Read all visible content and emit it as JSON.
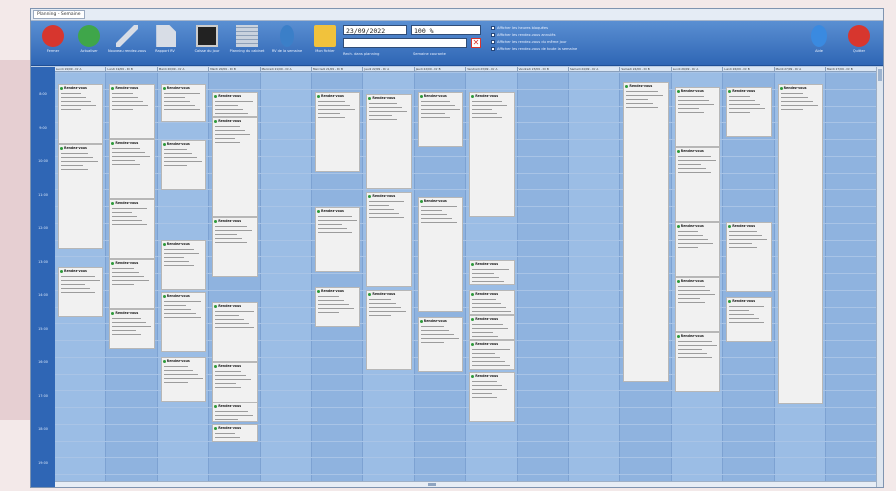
{
  "window": {
    "title": "Planning - Semaine"
  },
  "toolbar": {
    "buttons": [
      {
        "label": "Fermer",
        "icon": "close-red-icon",
        "color": "#d7362e"
      },
      {
        "label": "Actualiser",
        "icon": "refresh-icon",
        "color": "#3fa64a"
      },
      {
        "label": "Nouveau rendez-vous",
        "icon": "pen-icon",
        "color": "#d8dde6"
      },
      {
        "label": "Rapport RV",
        "icon": "document-arrow-icon",
        "color": "#d8dde6"
      },
      {
        "label": "Caisse du jour",
        "icon": "cash-register-icon",
        "color": "#222"
      },
      {
        "label": "Planning du cabinet",
        "icon": "calendar-grid-icon",
        "color": "#c9d2de"
      },
      {
        "label": "RV de la semaine",
        "icon": "person-icon",
        "color": "#3b7fc8"
      },
      {
        "label": "Mon fichier",
        "icon": "folder-icon",
        "color": "#f1c23c"
      }
    ],
    "date_value": "23/09/2022",
    "zoom_value": "100 %",
    "search_placeholder": "",
    "search_label": "Rech. dans planning",
    "current_week_label": "Semaine courante",
    "options": [
      "Afficher les heures bloquées",
      "Afficher les rendez-vous annulés",
      "Afficher les rendez-vous du même jour",
      "Afficher les rendez-vous de toute la semaine"
    ],
    "help_label": "Aide",
    "quit_label": "Quitter",
    "help_color": "#3a8ae0",
    "quit_color": "#d7362e"
  },
  "grid": {
    "times": [
      "8:00",
      "9:00",
      "10:00",
      "11:00",
      "12:00",
      "13:00",
      "14:00",
      "15:00",
      "16:00",
      "17:00",
      "18:00",
      "19:00",
      "20:00"
    ],
    "columns": [
      {
        "header": "Lundi 19/09 - Dr A"
      },
      {
        "header": "Lundi 19/09 - Dr B"
      },
      {
        "header": "Mardi 20/09 - Dr A"
      },
      {
        "header": "Mardi 20/09 - Dr B"
      },
      {
        "header": "Mercredi 21/09 - Dr A"
      },
      {
        "header": "Mercredi 21/09 - Dr B"
      },
      {
        "header": "Jeudi 22/09 - Dr A"
      },
      {
        "header": "Jeudi 22/09 - Dr B"
      },
      {
        "header": "Vendredi 23/09 - Dr A"
      },
      {
        "header": "Vendredi 23/09 - Dr B"
      },
      {
        "header": "Samedi 24/09 - Dr A"
      },
      {
        "header": "Samedi 24/09 - Dr B"
      },
      {
        "header": "Lundi 26/09 - Dr A"
      },
      {
        "header": "Lundi 26/09 - Dr B"
      },
      {
        "header": "Mardi 27/09 - Dr A"
      },
      {
        "header": "Mardi 27/09 - Dr B"
      }
    ],
    "appointments": [
      {
        "col": 0,
        "title": "Rendez-vous"
      },
      {
        "col": 0,
        "title": "Rendez-vous"
      },
      {
        "col": 0,
        "title": "Rendez-vous"
      },
      {
        "col": 1,
        "title": "Rendez-vous"
      },
      {
        "col": 1,
        "title": "Rendez-vous"
      },
      {
        "col": 1,
        "title": "Rendez-vous"
      },
      {
        "col": 1,
        "title": "Rendez-vous"
      },
      {
        "col": 1,
        "title": "Rendez-vous"
      },
      {
        "col": 2,
        "title": "Rendez-vous"
      },
      {
        "col": 2,
        "title": "Rendez-vous"
      },
      {
        "col": 2,
        "title": "Rendez-vous"
      },
      {
        "col": 2,
        "title": "Rendez-vous"
      },
      {
        "col": 2,
        "title": "Rendez-vous"
      },
      {
        "col": 2,
        "title": "Rendez-vous"
      },
      {
        "col": 3,
        "title": "Rendez-vous"
      },
      {
        "col": 3,
        "title": "Rendez-vous"
      },
      {
        "col": 3,
        "title": "Rendez-vous"
      },
      {
        "col": 3,
        "title": "Rendez-vous"
      },
      {
        "col": 3,
        "title": "Rendez-vous"
      },
      {
        "col": 3,
        "title": "Rendez-vous"
      },
      {
        "col": 3,
        "title": "Rendez-vous"
      },
      {
        "col": 5,
        "title": "Rendez-vous"
      },
      {
        "col": 5,
        "title": "Rendez-vous"
      },
      {
        "col": 5,
        "title": "Rendez-vous"
      },
      {
        "col": 6,
        "title": "Rendez-vous"
      },
      {
        "col": 6,
        "title": "Rendez-vous"
      },
      {
        "col": 6,
        "title": "Rendez-vous"
      },
      {
        "col": 7,
        "title": "Rendez-vous"
      },
      {
        "col": 7,
        "title": "Rendez-vous"
      },
      {
        "col": 7,
        "title": "Rendez-vous"
      },
      {
        "col": 8,
        "title": "Rendez-vous"
      },
      {
        "col": 8,
        "title": "Rendez-vous"
      },
      {
        "col": 8,
        "title": "Rendez-vous"
      },
      {
        "col": 8,
        "title": "Rendez-vous"
      },
      {
        "col": 8,
        "title": "Rendez-vous"
      },
      {
        "col": 8,
        "title": "Rendez-vous"
      },
      {
        "col": 11,
        "title": "Rendez-vous"
      },
      {
        "col": 11,
        "title": "Rendez-vous"
      },
      {
        "col": 12,
        "title": "Rendez-vous"
      },
      {
        "col": 12,
        "title": "Rendez-vous"
      },
      {
        "col": 12,
        "title": "Rendez-vous"
      },
      {
        "col": 12,
        "title": "Rendez-vous"
      },
      {
        "col": 12,
        "title": "Rendez-vous"
      },
      {
        "col": 13,
        "title": "Rendez-vous"
      },
      {
        "col": 13,
        "title": "Rendez-vous"
      },
      {
        "col": 13,
        "title": "Rendez-vous"
      },
      {
        "col": 14,
        "title": "Rendez-vous"
      }
    ]
  }
}
